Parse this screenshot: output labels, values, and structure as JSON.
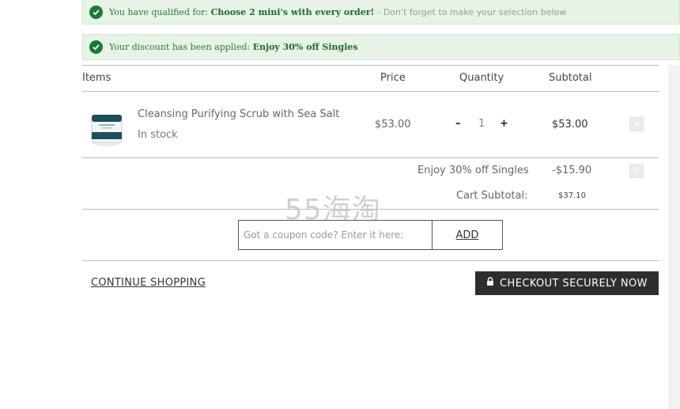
{
  "banners": {
    "qualified_prefix": "You have qualified for:",
    "qualified_bold": "Choose 2 mini's with every order!",
    "qualified_note": "- Don't forget to make your selection below",
    "discount_prefix": "Your discount has been applied:",
    "discount_bold": "Enjoy 30% off Singles"
  },
  "table": {
    "headers": {
      "items": "Items",
      "price": "Price",
      "quantity": "Quantity",
      "subtotal": "Subtotal"
    },
    "row": {
      "name": "Cleansing Purifying Scrub with Sea Salt",
      "stock": "In stock",
      "price": "$53.00",
      "qty_minus": "–",
      "qty": "1",
      "qty_plus": "+",
      "subtotal": "$53.00"
    },
    "discount": {
      "label": "Enjoy 30% off Singles",
      "amount": "-$15.90"
    },
    "cart_subtotal": {
      "label": "Cart Subtotal:",
      "amount": "$37.10"
    }
  },
  "coupon": {
    "placeholder": "Got a coupon code? Enter it here:",
    "add_label": "ADD"
  },
  "footer": {
    "continue_label": "CONTINUE SHOPPING",
    "checkout_label": "CHECKOUT SECURELY NOW"
  },
  "watermark": "55海淘",
  "icons": {
    "check": "check-circle-icon",
    "lock": "lock-icon",
    "remove": "remove-icon"
  },
  "colors": {
    "banner_bg": "#e7f3e7",
    "banner_text": "#2f7a3a",
    "check": "#1b7a36",
    "checkout_bg": "#2e2e2e"
  }
}
